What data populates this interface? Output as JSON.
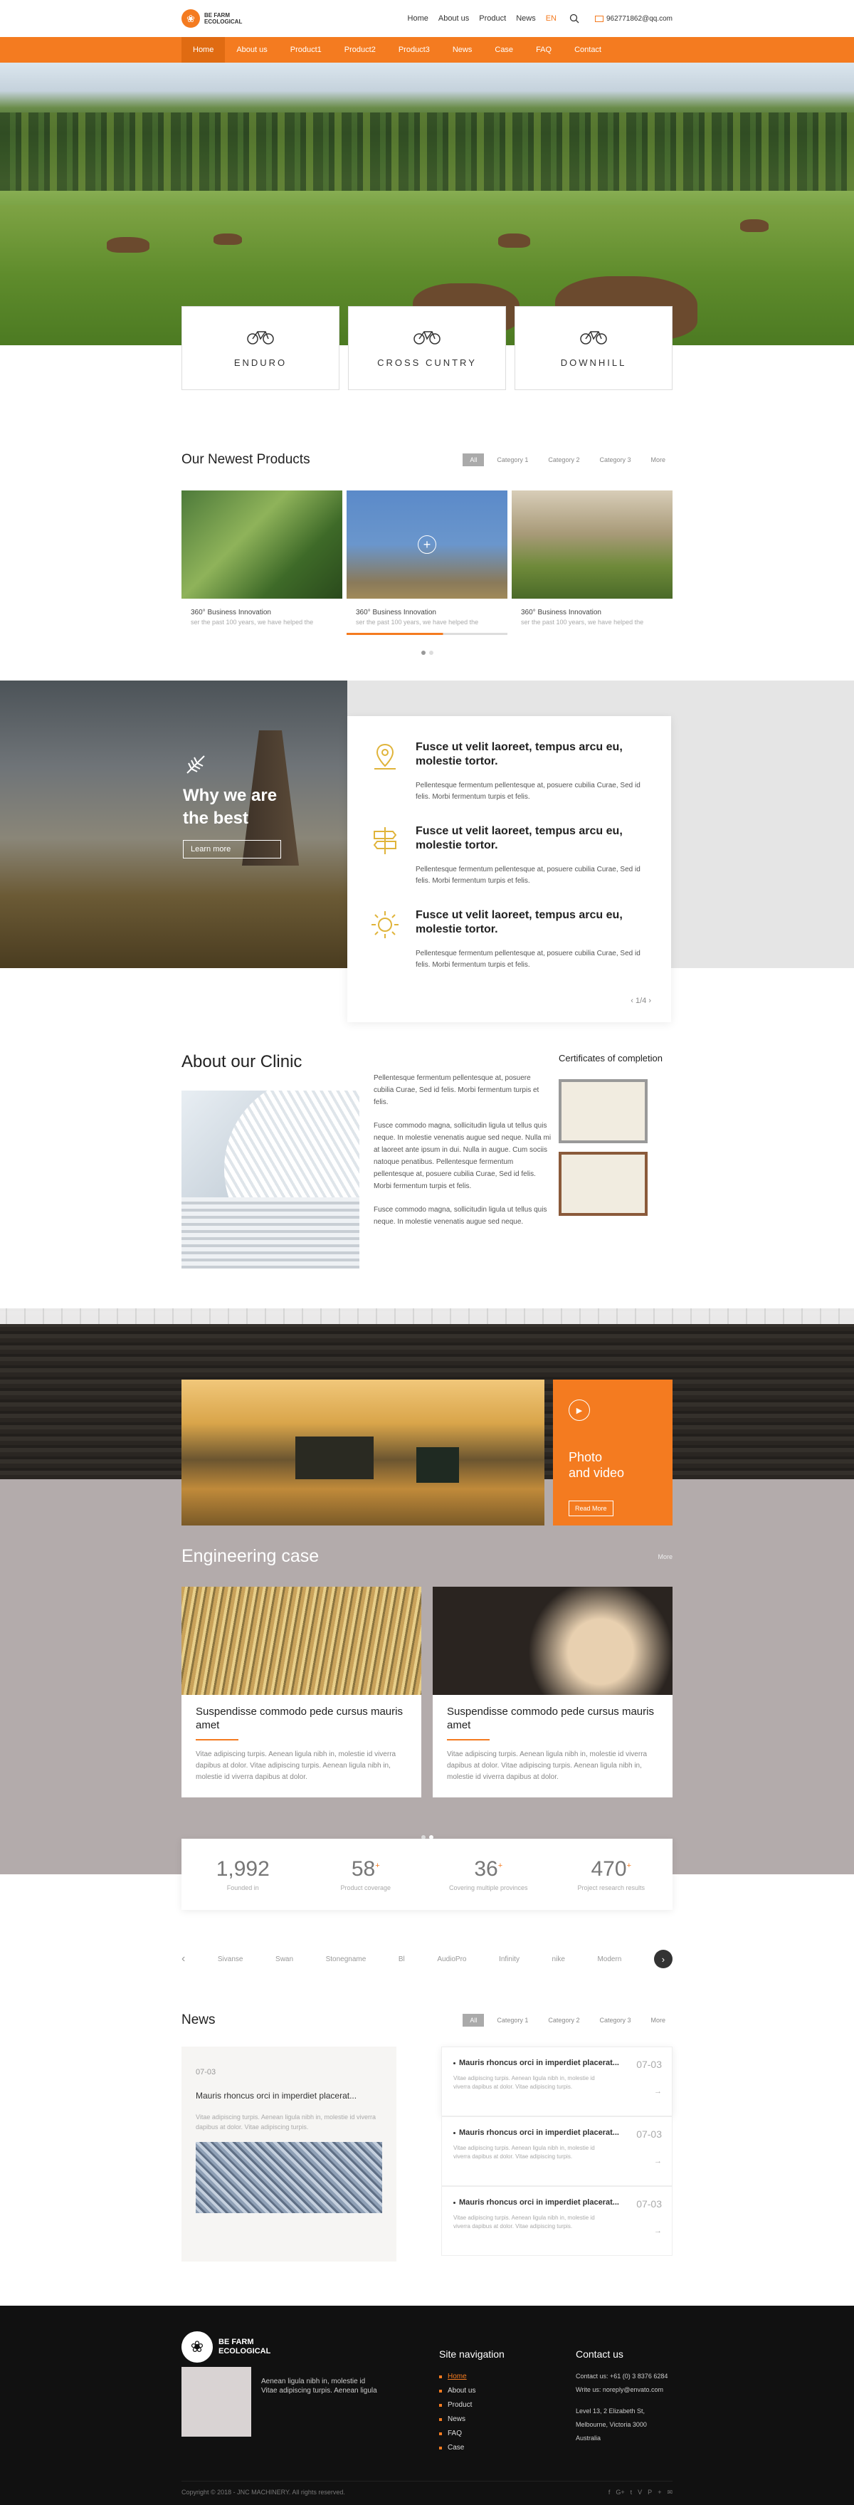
{
  "header": {
    "logo_line1": "BE FARM",
    "logo_line2": "ECOLOGICAL",
    "nav": [
      "Home",
      "About us",
      "Product",
      "News"
    ],
    "lang": "EN",
    "email": "962771862@qq.com"
  },
  "mainnav": [
    "Home",
    "About us",
    "Product1",
    "Product2",
    "Product3",
    "News",
    "Case",
    "FAQ",
    "Contact"
  ],
  "categories": [
    "ENDURO",
    "CROSS CUNTRY",
    "DOWNHILL"
  ],
  "newest": {
    "title": "Our Newest  Products",
    "filters": [
      "All",
      "Category 1",
      "Category 2",
      "Category 3",
      "More"
    ],
    "products": [
      {
        "title": "360° Business Innovation",
        "sub": "ser the past 100 years, we have helped the"
      },
      {
        "title": "360° Business Innovation",
        "sub": "ser the past 100 years, we have helped the"
      },
      {
        "title": "360° Business Innovation",
        "sub": "ser the past 100 years, we have helped the"
      }
    ]
  },
  "why": {
    "title_line1": "Why we are",
    "title_line2": "the best",
    "button": "Learn more",
    "features": [
      {
        "title": "Fusce ut velit laoreet,  tempus arcu eu, molestie tortor.",
        "text": "Pellentesque fermentum pellentesque at, posuere cubilia Curae, Sed id felis. Morbi fermentum turpis et felis."
      },
      {
        "title": "Fusce ut velit laoreet,  tempus arcu eu, molestie tortor.",
        "text": "Pellentesque fermentum pellentesque at, posuere cubilia Curae, Sed id felis. Morbi fermentum turpis et felis."
      },
      {
        "title": "Fusce ut velit laoreet,  tempus arcu eu, molestie tortor.",
        "text": "Pellentesque fermentum pellentesque at, posuere cubilia Curae, Sed id felis. Morbi fermentum turpis et felis."
      }
    ],
    "pager": "1/4"
  },
  "about": {
    "title": "About our Clinic",
    "p1": "Pellentesque fermentum pellentesque at, posuere cubilia Curae, Sed id felis. Morbi fermentum turpis et felis.",
    "p2": "Fusce commodo magna, sollicitudin ligula ut tellus quis neque. In molestie venenatis augue sed neque. Nulla mi at laoreet ante ipsum in dui. Nulla in augue. Cum sociis natoque penatibus. Pellentesque fermentum pellentesque at, posuere cubilia Curae, Sed id felis. Morbi fermentum turpis et felis.",
    "p3": "Fusce commodo magna, sollicitudin ligula ut tellus quis neque. In molestie venenatis augue sed neque.",
    "certs_title": "Certificates of completion"
  },
  "video": {
    "title_line1": "Photo",
    "title_line2": "and video",
    "button": "Read More"
  },
  "engineering": {
    "title": "Engineering case",
    "more": "More",
    "cards": [
      {
        "title": "Suspendisse commodo pede cursus mauris amet",
        "text": "Vitae adipiscing turpis. Aenean ligula nibh in, molestie id viverra dapibus at dolor. Vitae adipiscing turpis. Aenean ligula nibh in, molestie id viverra dapibus at dolor."
      },
      {
        "title": "Suspendisse commodo pede cursus mauris amet",
        "text": "Vitae adipiscing turpis. Aenean ligula nibh in, molestie id viverra dapibus at dolor. Vitae adipiscing turpis. Aenean ligula nibh in, molestie id viverra dapibus at dolor."
      }
    ]
  },
  "stats": [
    {
      "n": "1,992",
      "l": "Founded in"
    },
    {
      "n": "58",
      "l": "Product coverage"
    },
    {
      "n": "36",
      "l": "Covering multiple provinces"
    },
    {
      "n": "470",
      "l": "Project research results"
    }
  ],
  "brands": [
    "Sivanse",
    "Swan",
    "Stonegname",
    "Bl",
    "AudioPro",
    "Infinity",
    "nike",
    "Modern"
  ],
  "news": {
    "title": "News",
    "filters": [
      "All",
      "Category 1",
      "Category 2",
      "Category 3",
      "More"
    ],
    "big": {
      "date": "07-03",
      "title": "Mauris rhoncus orci in imperdiet placerat...",
      "text": "Vitae adipiscing turpis. Aenean ligula nibh in, molestie id viverra dapibus at dolor. Vitae adipiscing turpis."
    },
    "items": [
      {
        "title": "Mauris rhoncus orci in imperdiet placerat...",
        "text": "Vitae adipiscing turpis. Aenean ligula nibh in, molestie id viverra dapibus at dolor. Vitae adipiscing turpis.",
        "date": "07-03"
      },
      {
        "title": "Mauris rhoncus orci in imperdiet placerat...",
        "text": "Vitae adipiscing turpis. Aenean ligula nibh in, molestie id viverra dapibus at dolor. Vitae adipiscing turpis.",
        "date": "07-03"
      },
      {
        "title": "Mauris rhoncus orci in imperdiet placerat...",
        "text": "Vitae adipiscing turpis. Aenean ligula nibh in, molestie id viverra dapibus at dolor. Vitae adipiscing turpis.",
        "date": "07-03"
      }
    ]
  },
  "footer": {
    "logo_line1": "BE FARM",
    "logo_line2": "ECOLOGICAL",
    "blurb1": "Aenean ligula nibh in, molestie id",
    "blurb2": "Vitae adipiscing turpis. Aenean ligula",
    "nav_title": "Site navigation",
    "nav": [
      "Home",
      "About us",
      "Product",
      "News",
      "FAQ",
      "Case"
    ],
    "contact_title": "Contact us",
    "contact": [
      "Contact us: +61 (0) 3 8376 6284",
      "Write us: noreply@envato.com",
      "Level 13, 2 Elizabeth St,",
      "Melbourne, Victoria 3000",
      "Australia"
    ],
    "copyright": "Copyright © 2018 - JNC MACHINERY. All rights reserved.",
    "social": [
      "f",
      "G+",
      "t",
      "V",
      "P",
      "+",
      "✉"
    ]
  },
  "colors": {
    "accent": "#f47b20",
    "dark": "#111111",
    "eng_bg": "#b3abab"
  }
}
